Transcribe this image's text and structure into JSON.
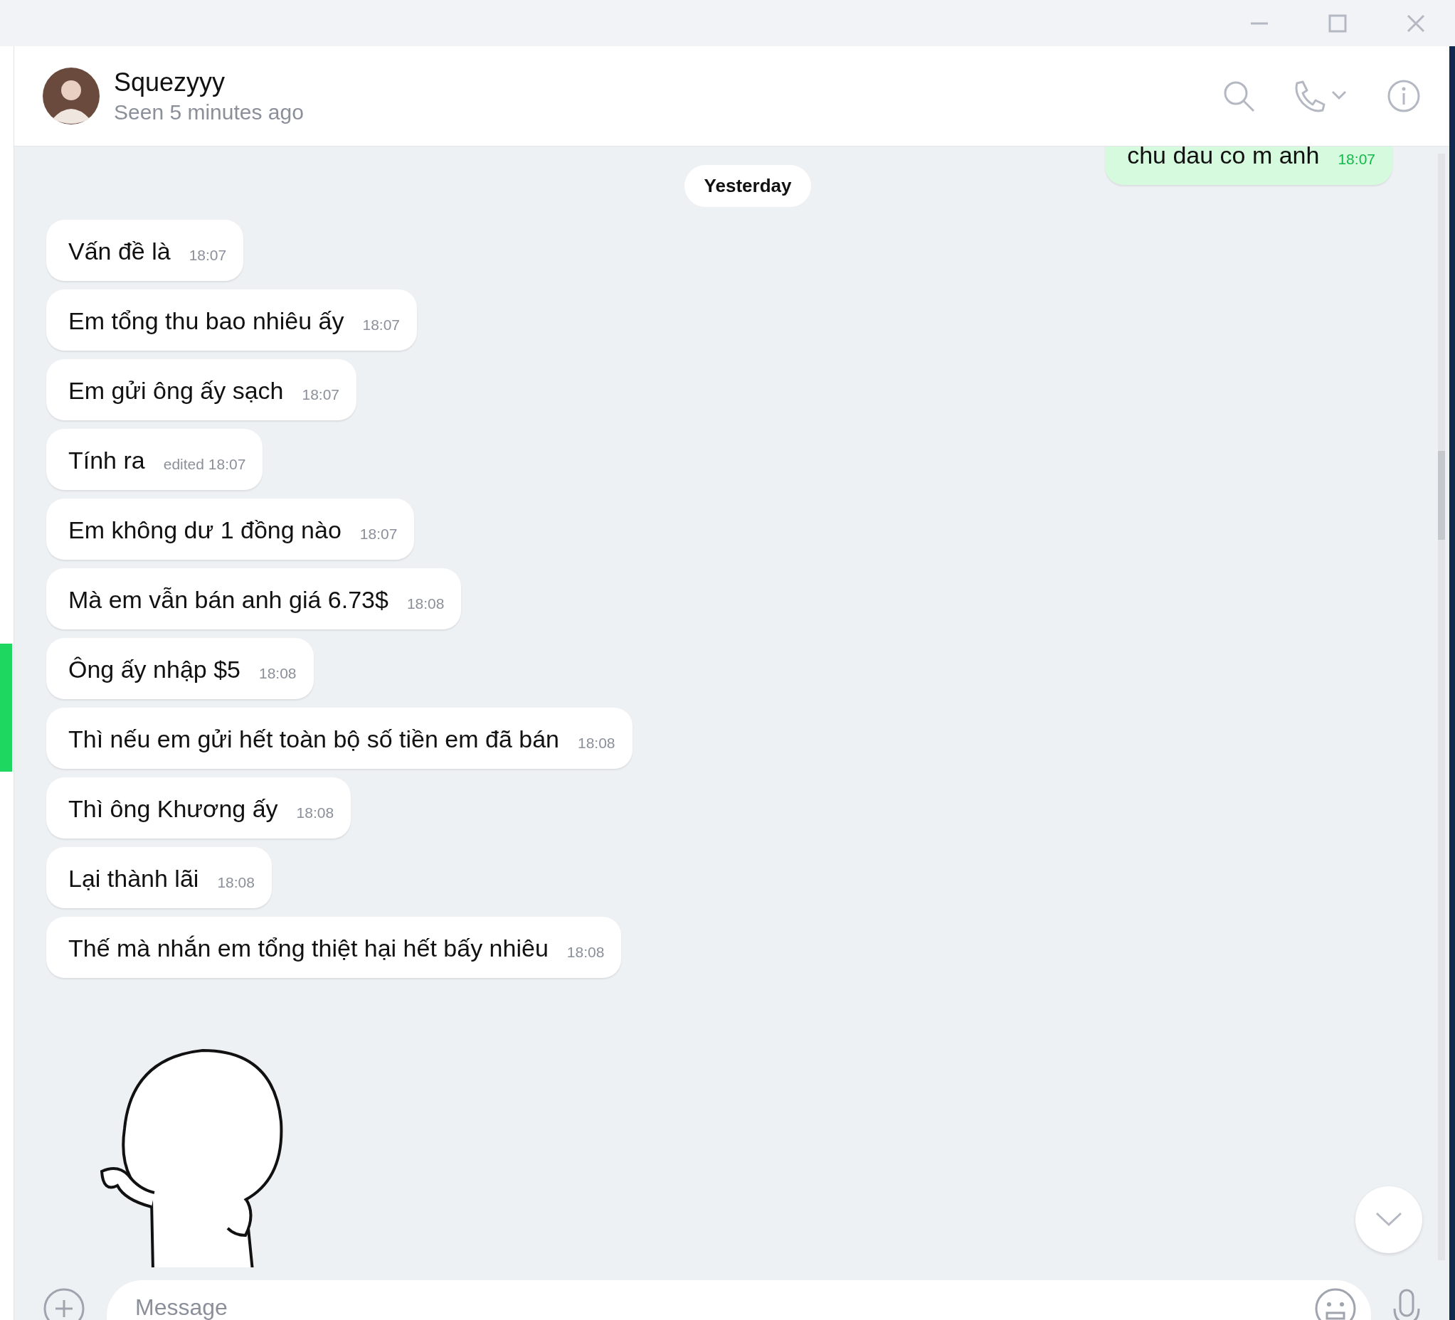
{
  "contact": {
    "name": "Squezyyy",
    "status": "Seen 5 minutes ago"
  },
  "messages": [
    {
      "kind": "outgoing",
      "text": "chu dau co m anh",
      "time": "18:07"
    },
    {
      "kind": "date",
      "text": "Yesterday"
    },
    {
      "kind": "incoming",
      "text": "Vấn đề là",
      "time": "18:07"
    },
    {
      "kind": "incoming",
      "text": "Em tổng thu bao nhiêu ấy",
      "time": "18:07"
    },
    {
      "kind": "incoming",
      "text": "Em gửi ông ấy sạch",
      "time": "18:07"
    },
    {
      "kind": "incoming",
      "text": "Tính ra",
      "time": "edited 18:07"
    },
    {
      "kind": "incoming",
      "text": "Em không dư 1 đồng nào",
      "time": "18:07"
    },
    {
      "kind": "incoming",
      "text": "Mà em vẫn bán anh giá 6.73$",
      "time": "18:08"
    },
    {
      "kind": "incoming",
      "text": "Ông ấy nhập $5",
      "time": "18:08"
    },
    {
      "kind": "incoming",
      "text": "Thì nếu em gửi hết toàn bộ số tiền em đã bán",
      "time": "18:08"
    },
    {
      "kind": "incoming",
      "text": "Thì ông Khương ấy",
      "time": "18:08"
    },
    {
      "kind": "incoming",
      "text": "Lại thành lãi",
      "time": "18:08"
    },
    {
      "kind": "incoming",
      "text": "Thế mà nhắn em tổng thiệt hại hết bấy nhiêu",
      "time": "18:08"
    },
    {
      "kind": "sticker"
    }
  ],
  "composer": {
    "placeholder": "Message"
  }
}
